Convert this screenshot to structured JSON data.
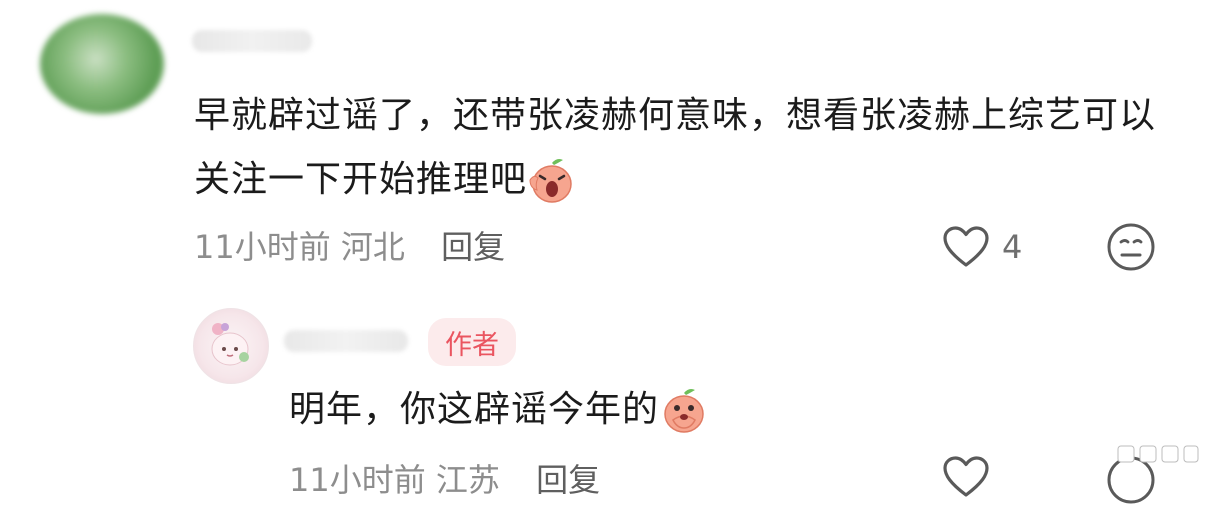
{
  "comment": {
    "text": "早就辟过谣了，还带张凌赫何意味，想看张凌赫上综艺可以关注一下开始推理吧",
    "emoji_icon": "peach-scream-emoji-icon",
    "time": "11小时前",
    "location": "河北",
    "reply_label": "回复",
    "like_count": "4",
    "like_icon": "heart-icon",
    "dislike_icon": "meh-face-icon"
  },
  "reply": {
    "author_badge": "作者",
    "text": "明年，你这辟谣今年的",
    "emoji_icon": "peach-cover-mouth-emoji-icon",
    "time": "11小时前",
    "location": "江苏",
    "reply_label": "回复"
  },
  "colors": {
    "badge_text": "#ea5560",
    "badge_bg": "#fcebec",
    "meta_text": "#8d8d8d"
  }
}
